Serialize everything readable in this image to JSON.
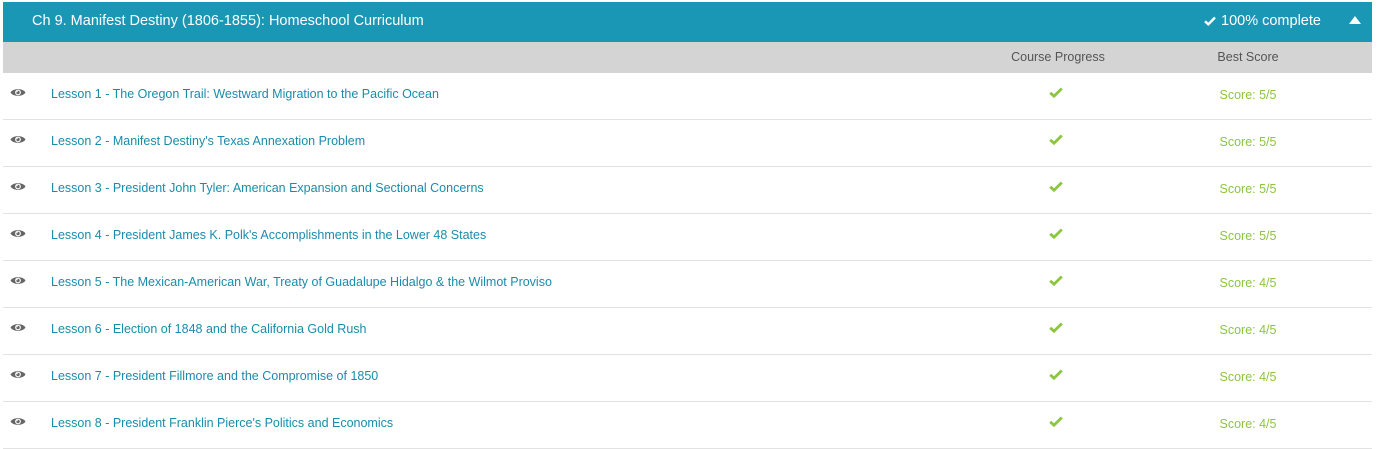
{
  "chapter": {
    "title": "Ch 9. Manifest Destiny (1806-1855): Homeschool Curriculum",
    "completion": "100% complete",
    "header_color": "#1a97b5",
    "check_color": "#8cc63f",
    "link_color": "#1a8cab"
  },
  "columns": {
    "progress": "Course Progress",
    "score": "Best Score"
  },
  "lessons": [
    {
      "title": "Lesson 1 - The Oregon Trail: Westward Migration to the Pacific Ocean",
      "completed": true,
      "score": "Score: 5/5"
    },
    {
      "title": "Lesson 2 - Manifest Destiny's Texas Annexation Problem",
      "completed": true,
      "score": "Score: 5/5"
    },
    {
      "title": "Lesson 3 - President John Tyler: American Expansion and Sectional Concerns",
      "completed": true,
      "score": "Score: 5/5"
    },
    {
      "title": "Lesson 4 - President James K. Polk's Accomplishments in the Lower 48 States",
      "completed": true,
      "score": "Score: 5/5"
    },
    {
      "title": "Lesson 5 - The Mexican-American War, Treaty of Guadalupe Hidalgo & the Wilmot Proviso",
      "completed": true,
      "score": "Score: 4/5"
    },
    {
      "title": "Lesson 6 - Election of 1848 and the California Gold Rush",
      "completed": true,
      "score": "Score: 4/5"
    },
    {
      "title": "Lesson 7 - President Fillmore and the Compromise of 1850",
      "completed": true,
      "score": "Score: 4/5"
    },
    {
      "title": "Lesson 8 - President Franklin Pierce's Politics and Economics",
      "completed": true,
      "score": "Score: 4/5"
    }
  ]
}
